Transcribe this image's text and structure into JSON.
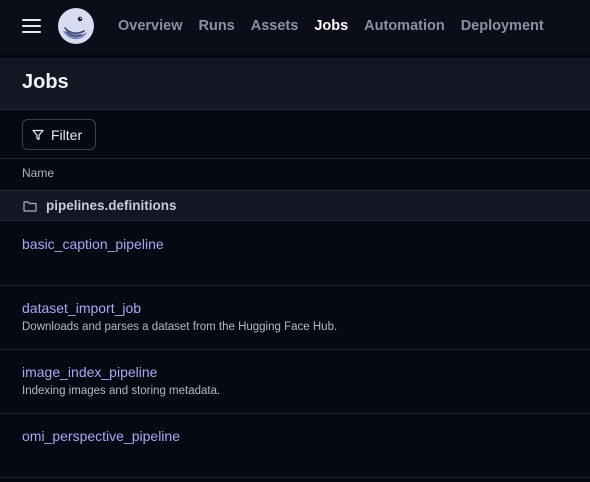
{
  "nav": {
    "menu_icon": "hamburger-menu-icon",
    "logo_icon": "octopus-logo-icon",
    "items": [
      {
        "label": "Overview"
      },
      {
        "label": "Runs"
      },
      {
        "label": "Assets"
      },
      {
        "label": "Jobs",
        "active": true
      },
      {
        "label": "Automation"
      },
      {
        "label": "Deployment"
      }
    ]
  },
  "page": {
    "title": "Jobs"
  },
  "toolbar": {
    "filter_label": "Filter",
    "filter_icon": "filter-icon"
  },
  "table": {
    "column_name": "Name",
    "group": {
      "icon": "folder-icon",
      "label": "pipelines.definitions"
    },
    "jobs": [
      {
        "name": "basic_caption_pipeline",
        "description": ""
      },
      {
        "name": "dataset_import_job",
        "description": "Downloads and parses a dataset from the Hugging Face Hub."
      },
      {
        "name": "image_index_pipeline",
        "description": "Indexing images and storing metadata."
      },
      {
        "name": "omi_perspective_pipeline",
        "description": ""
      }
    ]
  },
  "colors": {
    "background": "#060812",
    "topbar": "#0b0e18",
    "header": "#131724",
    "link": "#a9a7f5",
    "active_nav": "#ffffff",
    "inactive_nav": "#8b90a2"
  }
}
